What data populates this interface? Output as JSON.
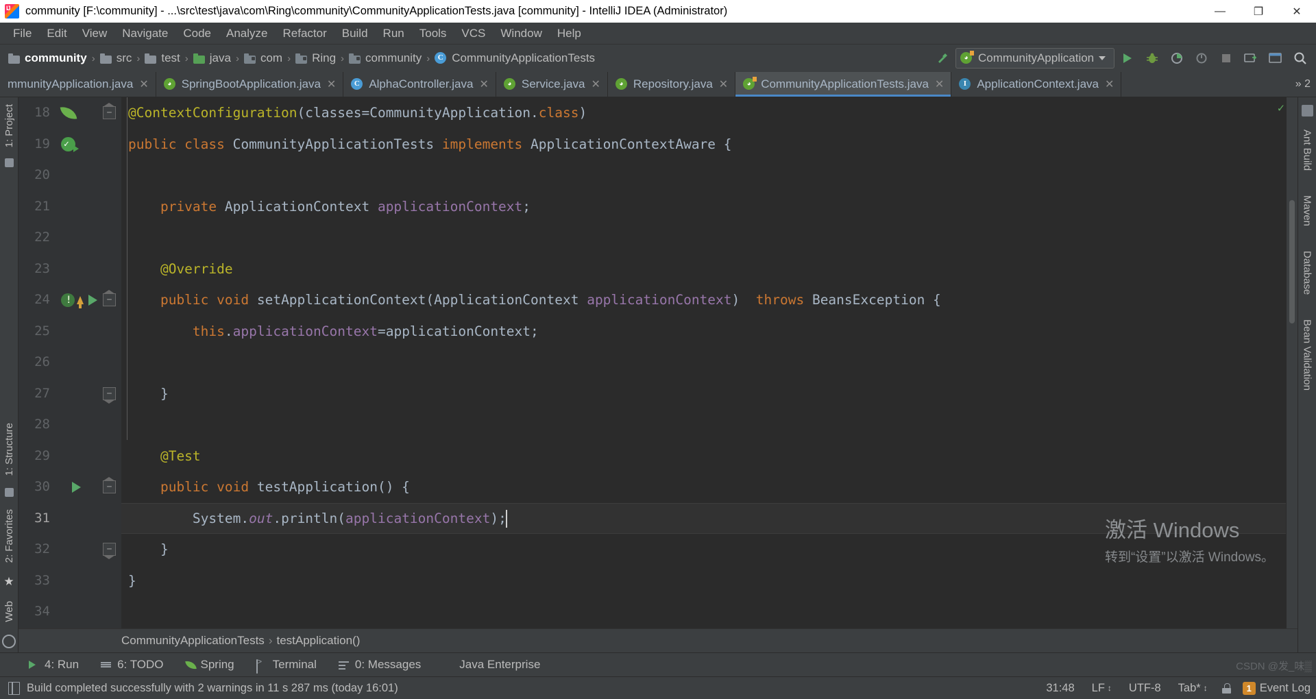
{
  "window": {
    "title": "community [F:\\community] - ...\\src\\test\\java\\com\\Ring\\community\\CommunityApplicationTests.java [community] - IntelliJ IDEA (Administrator)",
    "app_icon": "intellij-idea-icon",
    "minimize": "—",
    "maximize": "❐",
    "close": "✕"
  },
  "menu": {
    "items": [
      {
        "label": "File"
      },
      {
        "label": "Edit"
      },
      {
        "label": "View"
      },
      {
        "label": "Navigate"
      },
      {
        "label": "Code"
      },
      {
        "label": "Analyze"
      },
      {
        "label": "Refactor"
      },
      {
        "label": "Build"
      },
      {
        "label": "Run"
      },
      {
        "label": "Tools"
      },
      {
        "label": "VCS"
      },
      {
        "label": "Window"
      },
      {
        "label": "Help"
      }
    ]
  },
  "navbar": {
    "breadcrumbs": [
      {
        "label": "community",
        "icon": "folder-icon",
        "kind": "module"
      },
      {
        "label": "src",
        "icon": "folder-icon",
        "kind": "folder"
      },
      {
        "label": "test",
        "icon": "folder-icon",
        "kind": "folder"
      },
      {
        "label": "java",
        "icon": "source-folder-icon",
        "kind": "source"
      },
      {
        "label": "com",
        "icon": "package-icon",
        "kind": "package"
      },
      {
        "label": "Ring",
        "icon": "package-icon",
        "kind": "package"
      },
      {
        "label": "community",
        "icon": "package-icon",
        "kind": "package"
      },
      {
        "label": "CommunityApplicationTests",
        "icon": "java-class-icon",
        "kind": "class"
      }
    ],
    "separator": "›",
    "run_config": {
      "name": "CommunityApplication",
      "icon": "spring-boot-icon",
      "dropdown_icon": "chevron-down-icon"
    },
    "buttons": [
      {
        "name": "build-hammer-icon"
      },
      {
        "name": "run-button",
        "icon": "play-icon"
      },
      {
        "name": "debug-button",
        "icon": "bug-icon"
      },
      {
        "name": "run-with-coverage-button",
        "icon": "coverage-icon"
      },
      {
        "name": "profile-button",
        "icon": "profiler-icon"
      },
      {
        "name": "stop-button",
        "icon": "stop-icon"
      },
      {
        "name": "update-application-button",
        "icon": "update-icon"
      },
      {
        "name": "open-browser-button",
        "icon": "browser-icon"
      },
      {
        "name": "search-everywhere-button",
        "icon": "search-icon"
      }
    ]
  },
  "tabs": {
    "items": [
      {
        "label": "mmunityApplication.java",
        "icon": "java-class-icon",
        "active": false,
        "close": "✕"
      },
      {
        "label": "SpringBootApplication.java",
        "icon": "spring-icon",
        "active": false,
        "close": "✕"
      },
      {
        "label": "AlphaController.java",
        "icon": "java-class-icon",
        "active": false,
        "close": "✕"
      },
      {
        "label": "Service.java",
        "icon": "spring-icon",
        "active": false,
        "close": "✕"
      },
      {
        "label": "Repository.java",
        "icon": "spring-icon",
        "active": false,
        "close": "✕"
      },
      {
        "label": "CommunityApplicationTests.java",
        "icon": "spring-test-icon",
        "active": true,
        "close": "✕"
      },
      {
        "label": "ApplicationContext.java",
        "icon": "java-interface-icon",
        "active": false,
        "close": "✕"
      }
    ],
    "overflow": "» 2"
  },
  "left_strip": {
    "top": "1: Project",
    "items": [
      "structure-icon",
      "favorites-icon"
    ],
    "bottom_labels": [
      "1: Structure",
      "2: Favorites",
      "Web"
    ]
  },
  "right_strip": {
    "labels": [
      "Ant Build",
      "Maven",
      "Database",
      "Bean Validation"
    ]
  },
  "editor": {
    "first_line": 18,
    "current_line": 31,
    "lines": [
      {
        "n": 18,
        "segments": [
          {
            "t": "@ContextConfiguration",
            "c": "ann"
          },
          {
            "t": "(",
            "c": "punc"
          },
          {
            "t": "classes",
            "c": "cls"
          },
          {
            "t": "=",
            "c": "punc"
          },
          {
            "t": "CommunityApplication.",
            "c": "cls"
          },
          {
            "t": "class",
            "c": "kw"
          },
          {
            "t": ")",
            "c": "punc"
          }
        ]
      },
      {
        "n": 19,
        "segments": [
          {
            "t": "public class ",
            "c": "kw"
          },
          {
            "t": "CommunityApplicationTests ",
            "c": "cls"
          },
          {
            "t": "implements ",
            "c": "kw"
          },
          {
            "t": "ApplicationContextAware {",
            "c": "cls"
          }
        ]
      },
      {
        "n": 20,
        "segments": []
      },
      {
        "n": 21,
        "segments": [
          {
            "t": "    private ",
            "c": "kw"
          },
          {
            "t": "ApplicationContext ",
            "c": "cls"
          },
          {
            "t": "applicationContext",
            "c": "fld"
          },
          {
            "t": ";",
            "c": "punc"
          }
        ]
      },
      {
        "n": 22,
        "segments": []
      },
      {
        "n": 23,
        "segments": [
          {
            "t": "    @Override",
            "c": "ann"
          }
        ]
      },
      {
        "n": 24,
        "segments": [
          {
            "t": "    public void ",
            "c": "kw"
          },
          {
            "t": "setApplicationContext",
            "c": "mth"
          },
          {
            "t": "(",
            "c": "punc"
          },
          {
            "t": "ApplicationContext ",
            "c": "cls"
          },
          {
            "t": "applicationContext",
            "c": "fld"
          },
          {
            "t": ")  ",
            "c": "punc"
          },
          {
            "t": "throws ",
            "c": "kw"
          },
          {
            "t": "BeansException {",
            "c": "cls"
          }
        ]
      },
      {
        "n": 25,
        "segments": [
          {
            "t": "        this",
            "c": "kw"
          },
          {
            "t": ".",
            "c": "punc"
          },
          {
            "t": "applicationContext",
            "c": "fld"
          },
          {
            "t": "=applicationContext;",
            "c": "punc"
          }
        ]
      },
      {
        "n": 26,
        "segments": []
      },
      {
        "n": 27,
        "segments": [
          {
            "t": "    }",
            "c": "punc"
          }
        ]
      },
      {
        "n": 28,
        "segments": []
      },
      {
        "n": 29,
        "segments": [
          {
            "t": "    @Test",
            "c": "ann"
          }
        ]
      },
      {
        "n": 30,
        "segments": [
          {
            "t": "    public void ",
            "c": "kw"
          },
          {
            "t": "testApplication",
            "c": "mth"
          },
          {
            "t": "() {",
            "c": "punc"
          }
        ]
      },
      {
        "n": 31,
        "segments": [
          {
            "t": "        System.",
            "c": "cls"
          },
          {
            "t": "out",
            "c": "stat"
          },
          {
            "t": ".println(",
            "c": "punc"
          },
          {
            "t": "applicationContext",
            "c": "fld"
          },
          {
            "t": ");",
            "c": "punc"
          }
        ]
      },
      {
        "n": 32,
        "segments": [
          {
            "t": "    }",
            "c": "punc"
          }
        ]
      },
      {
        "n": 33,
        "segments": [
          {
            "t": "}",
            "c": "punc"
          }
        ]
      },
      {
        "n": 34,
        "segments": []
      }
    ],
    "breadcrumbs": [
      {
        "label": "CommunityApplicationTests"
      },
      {
        "label": "testApplication()"
      }
    ],
    "breadcrumb_separator": "›",
    "inspection_status": "✓"
  },
  "watermark": {
    "line1": "激活 Windows",
    "line2": "转到“设置”以激活 Windows。",
    "csdn": "CSDN @发_味▒"
  },
  "bottom_tools": {
    "items": [
      {
        "label": "4: Run",
        "mnemonic": "4",
        "icon": "play-icon"
      },
      {
        "label": "6: TODO",
        "mnemonic": "6",
        "icon": "todo-list-icon"
      },
      {
        "label": "Spring",
        "mnemonic": "",
        "icon": "spring-leaf-icon"
      },
      {
        "label": "Terminal",
        "mnemonic": "",
        "icon": "terminal-icon"
      },
      {
        "label": "0: Messages",
        "mnemonic": "0",
        "icon": "messages-icon"
      },
      {
        "label": "Java Enterprise",
        "mnemonic": "",
        "icon": "java-enterprise-icon"
      }
    ]
  },
  "statusbar": {
    "message": "Build completed successfully with 2 warnings in 11 s 287 ms (today 16:01)",
    "message_icon": "build-log-icon",
    "position": "31:48",
    "line_separator": "LF",
    "encoding": "UTF-8",
    "indent": "Tab*",
    "lock_icon": "lock-icon",
    "event_log": "Event Log",
    "event_badge": "1"
  },
  "colors": {
    "accent_blue": "#4a88c7",
    "editor_bg": "#2b2b2b",
    "chrome_bg": "#3c3f41",
    "keyword": "#cc7832",
    "annotation": "#bbb529",
    "field": "#9876aa",
    "text": "#a9b7c6",
    "green": "#59a869"
  }
}
